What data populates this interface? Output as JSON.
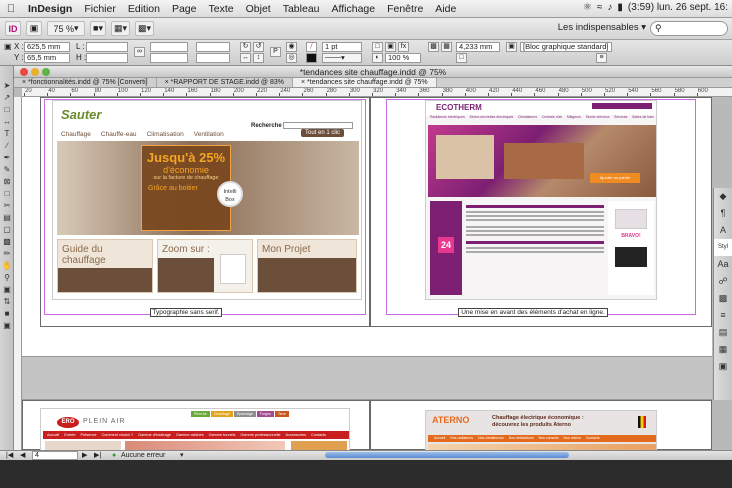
{
  "menubar": {
    "app": "InDesign",
    "items": [
      "Fichier",
      "Edition",
      "Page",
      "Texte",
      "Objet",
      "Tableau",
      "Affichage",
      "Fenêtre",
      "Aide"
    ],
    "clock": "(3:59)  lun. 26 sept.  16:"
  },
  "appbar": {
    "zoom": "75 %",
    "workspace": "Les indispensables",
    "search_placeholder": ""
  },
  "control": {
    "x_label": "X :",
    "x_value": "625,5 mm",
    "y_label": "Y :",
    "y_value": "65,5 mm",
    "l_label": "L :",
    "h_label": "H :",
    "stroke": "1 pt",
    "size_value": "4,233 mm",
    "percent": "100 %",
    "style": "[Bloc graphique standard]"
  },
  "document": {
    "title": "*tendances site chauffage.indd @ 75%",
    "tabs": [
      "*fonctionnalités.indd @ 75% [Converti]",
      "*RAPPORT DE STAGE.indd @ 83%",
      "*tendances site chauffage.indd @ 75%"
    ]
  },
  "ruler": {
    "labels": [
      "20",
      "40",
      "60",
      "80",
      "100",
      "120",
      "140",
      "160",
      "180",
      "200",
      "220",
      "240",
      "260",
      "280",
      "300",
      "320",
      "340",
      "360",
      "380",
      "400",
      "420",
      "440",
      "460",
      "480",
      "500",
      "520",
      "540",
      "560",
      "580",
      "600"
    ]
  },
  "captions": {
    "left": "Typographie sans serif.",
    "right": "Une mise en avant des éléments d'achat en ligne."
  },
  "sauter": {
    "logo": "Sauter",
    "search_label": "Recherche",
    "nav": [
      "Chauffage",
      "Chauffe-eau",
      "Climatisation",
      "Ventilation"
    ],
    "top_button": "Tout en 1 clic",
    "promo_big": "Jusqu'à 25%",
    "promo_mid": "d'économie",
    "promo_small": "sur la facture de chauffage",
    "promo_sub": "Grâce au boitier",
    "promo_brand": "Intelli Box",
    "cards": [
      "Guide du chauffage",
      "Zoom sur :",
      "Mon Projet"
    ]
  },
  "eco": {
    "brand": "ECOTHERM",
    "nav": [
      "Radiateurs électriques",
      "Sèche-serviettes électriques",
      "Climatiseurs",
      "Centrale d'air",
      "Mitigeurs",
      "Sèche cheveux",
      "Services",
      "Salles de bain"
    ],
    "badge": "24",
    "right_head": "BRAVO!",
    "cta": "Ajouter au panier"
  },
  "plein": {
    "logo": "ERO",
    "title": "PLEIN AIR",
    "nav": [
      "Accueil",
      "Entrée",
      "Présence",
      "Comment choisir ?",
      "Gamme d'éclairage",
      "Gamme cabines",
      "Gamme tunnels",
      "Gamme professionnelle",
      "Accessoires",
      "Contacts"
    ],
    "tags": [
      "Plein Air",
      "Chauffage",
      "Épandage",
      "Forges",
      "Terre"
    ]
  },
  "aterno": {
    "logo": "ATERNO",
    "headline": "Chauffage électrique économique : découvrez les produits Aterno",
    "nav": [
      "Accueil",
      "Nos radiateurs",
      "Nos climatiseurs",
      "Nos réalisations",
      "Nos conseils",
      "Nos vidéos",
      "Contacts"
    ]
  },
  "status": {
    "page": "4",
    "errors": "Aucune erreur"
  },
  "colors": {
    "sauter_brown": "#6b4f3a",
    "sauter_orange": "#d96a1a",
    "eco_purple": "#7d1f72",
    "eco_pink": "#c23a8e",
    "plein_red": "#c81e1e",
    "aterno_orange": "#e46b1e"
  }
}
